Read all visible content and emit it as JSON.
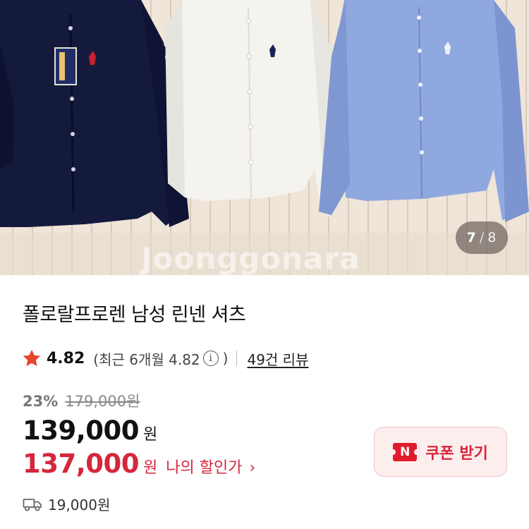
{
  "gallery": {
    "current": "7",
    "separator": "/",
    "total": "8",
    "watermark": "Joonggonara"
  },
  "product": {
    "title": "폴로랄프로렌 남성 린넨 셔츠",
    "rating": {
      "score": "4.82",
      "recent_text": "(최근 6개월 4.82",
      "info_glyph": "i",
      "recent_close": ")",
      "reviews_link": "49건 리뷰"
    },
    "pricing": {
      "discount_rate": "23%",
      "original_price": "179,000원",
      "price": "139,000",
      "price_unit": "원",
      "my_price": "137,000",
      "my_price_unit": "원",
      "my_price_label": "나의 할인가",
      "chevron": "›"
    },
    "coupon": {
      "icon_text": "N",
      "label": "쿠폰 받기"
    },
    "shipping": {
      "fee": "19,000원"
    }
  },
  "colors": {
    "accent_red": "#d5273b",
    "coupon_bg": "#fdeeee",
    "star": "#e8432e"
  },
  "icons": {
    "star": "star-icon",
    "info": "info-icon",
    "coupon": "naver-coupon-icon",
    "shipping": "truck-icon"
  }
}
